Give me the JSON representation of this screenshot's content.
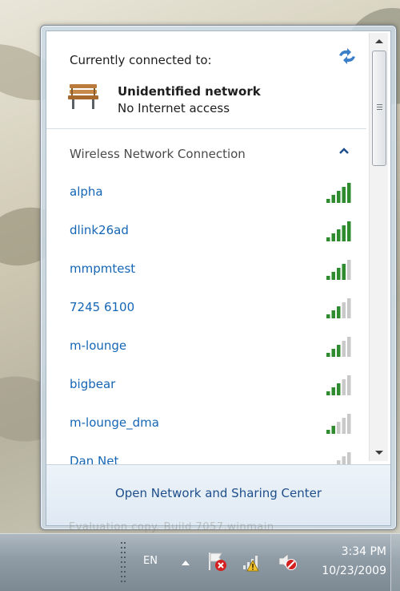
{
  "flyout": {
    "current_label": "Currently connected to:",
    "connected_network": {
      "name": "Unidentified network",
      "status": "No Internet access",
      "icon": "bench-icon"
    },
    "section_header": "Wireless Network Connection",
    "networks": [
      {
        "ssid": "alpha",
        "signal_bars": 5
      },
      {
        "ssid": "dlink26ad",
        "signal_bars": 5
      },
      {
        "ssid": "mmpmtest",
        "signal_bars": 4
      },
      {
        "ssid": "7245 6100",
        "signal_bars": 3
      },
      {
        "ssid": "m-lounge",
        "signal_bars": 3
      },
      {
        "ssid": "bigbear",
        "signal_bars": 3
      },
      {
        "ssid": "m-lounge_dma",
        "signal_bars": 2
      },
      {
        "ssid": "Dan Net",
        "signal_bars": 2
      }
    ],
    "footer_link": "Open Network and Sharing Center"
  },
  "taskbar": {
    "language": "EN",
    "time": "3:34 PM",
    "date": "10/23/2009"
  },
  "colors": {
    "link": "#1566b5",
    "signal_on": "#2e8b2e",
    "signal_off": "#c9c9c9"
  }
}
